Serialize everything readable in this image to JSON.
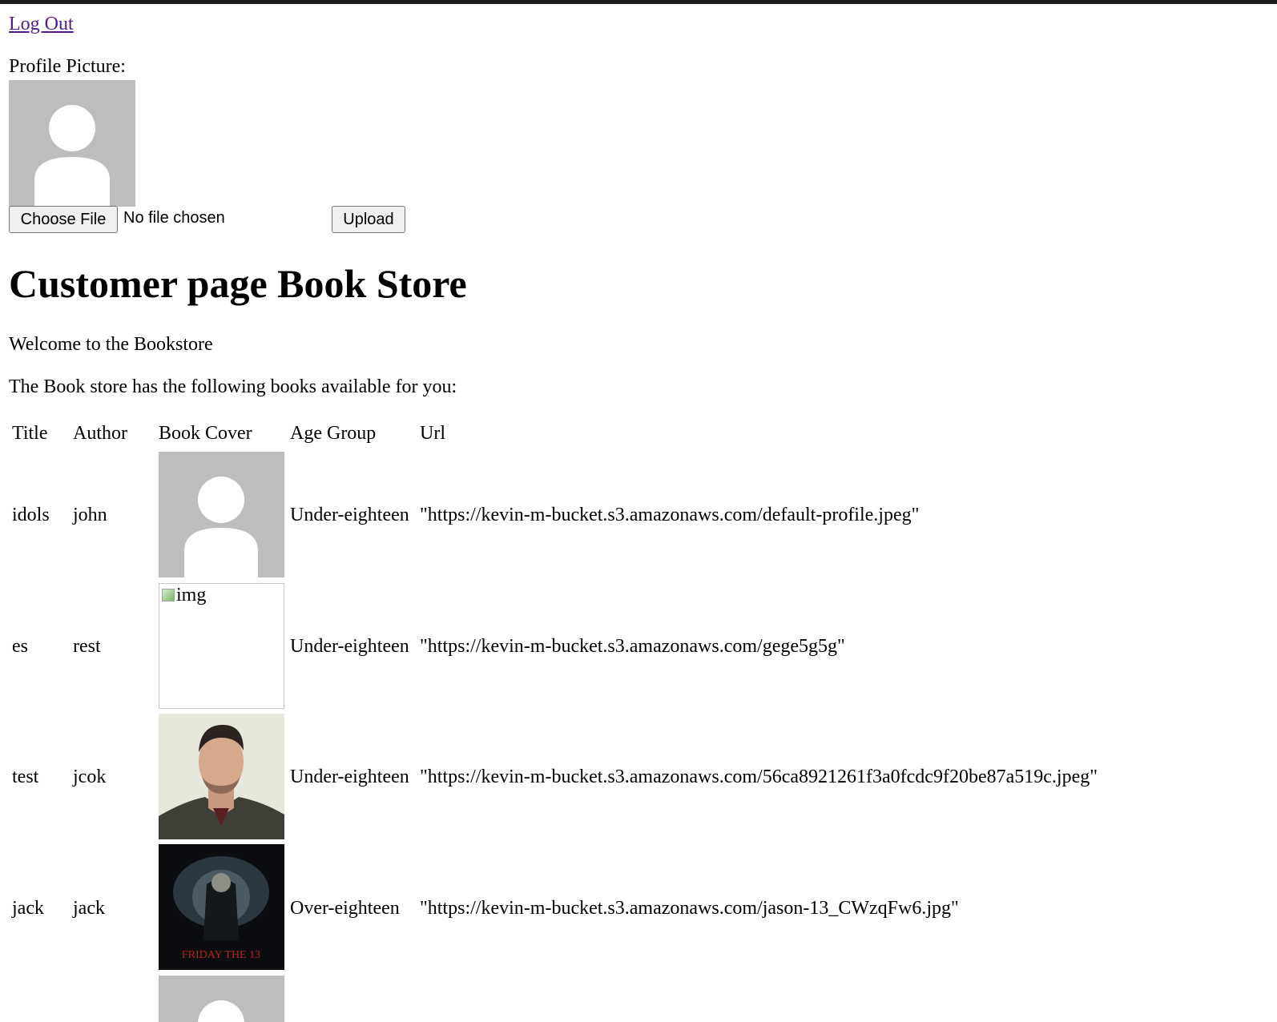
{
  "header": {
    "logout_label": "Log Out"
  },
  "profile": {
    "label": "Profile Picture:",
    "choose_file_label": "Choose File",
    "file_status": "No file chosen",
    "upload_label": "Upload"
  },
  "main": {
    "title": "Customer page Book Store",
    "welcome": "Welcome to the Bookstore",
    "intro": "The Book store has the following books available for you:"
  },
  "table": {
    "headers": [
      "Title",
      "Author",
      "Book Cover",
      "Age Group",
      "Url"
    ],
    "rows": [
      {
        "title": "idols",
        "author": "john",
        "cover": "default-profile",
        "age_group": "Under-eighteen",
        "url": "\"https://kevin-m-bucket.s3.amazonaws.com/default-profile.jpeg\""
      },
      {
        "title": "es",
        "author": "rest",
        "cover": "broken-image",
        "cover_alt": "img",
        "age_group": "Under-eighteen",
        "url": "\"https://kevin-m-bucket.s3.amazonaws.com/gege5g5g\""
      },
      {
        "title": "test",
        "author": "jcok",
        "cover": "portrait-photo",
        "age_group": "Under-eighteen",
        "url": "\"https://kevin-m-bucket.s3.amazonaws.com/56ca8921261f3a0fcdc9f20be87a519c.jpeg\""
      },
      {
        "title": "jack",
        "author": "jack",
        "cover": "movie-poster",
        "cover_text": "FRIDAY THE 13",
        "age_group": "Over-eighteen",
        "url": "\"https://kevin-m-bucket.s3.amazonaws.com/jason-13_CWzqFw6.jpg\""
      }
    ],
    "partial_row": {
      "cover": "default-profile"
    }
  },
  "colors": {
    "link": "#551a8b",
    "avatar_bg": "#bdbdbd",
    "button_bg": "#efefef"
  }
}
